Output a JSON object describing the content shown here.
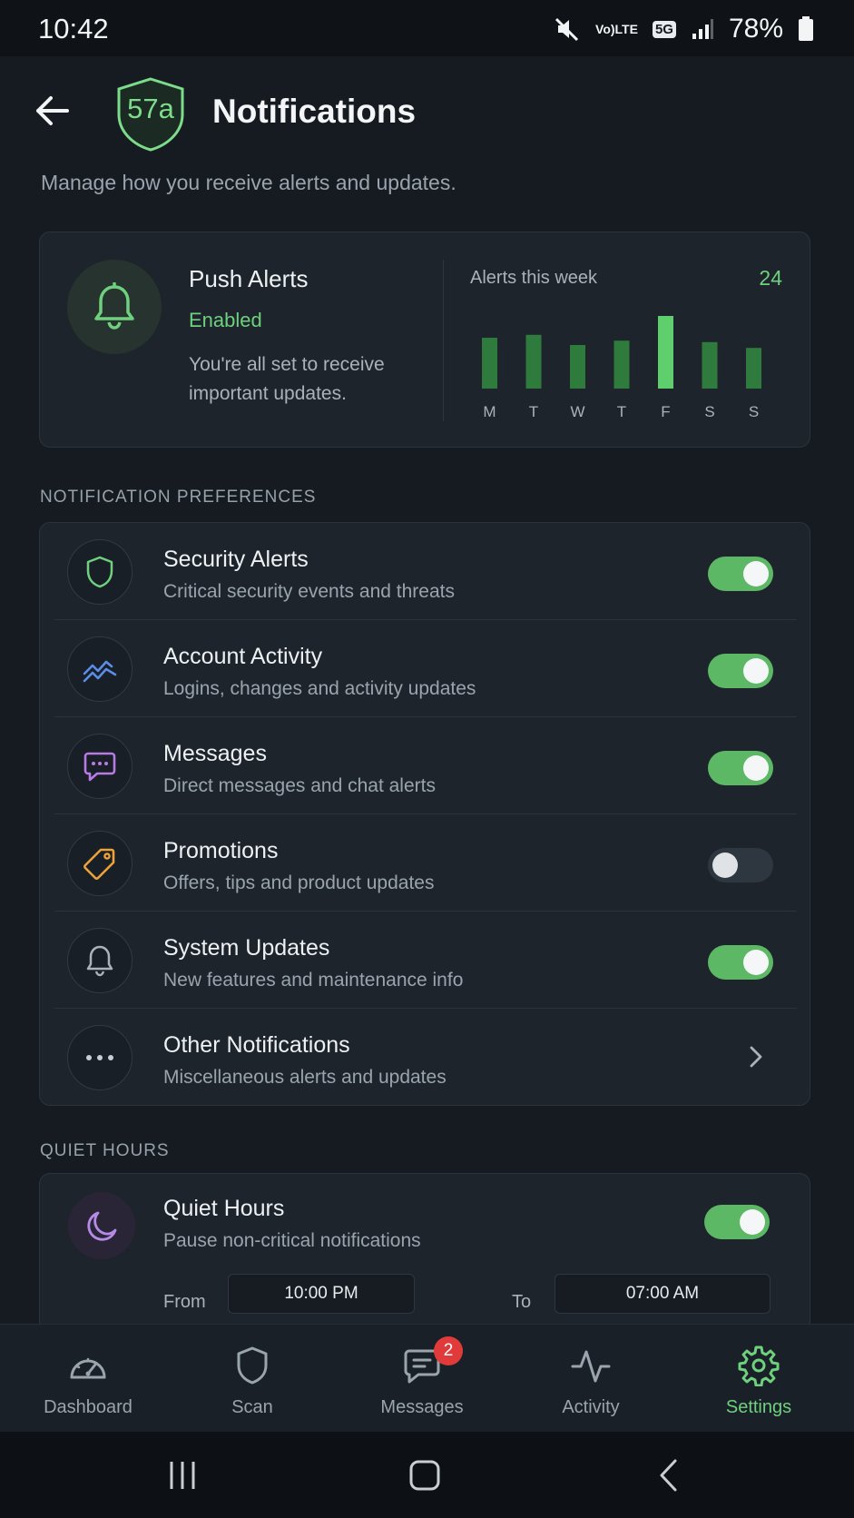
{
  "status_bar": {
    "time": "10:42",
    "volte_top": "Vo)",
    "volte_bottom": "LTE",
    "network": "5G",
    "battery": "78%",
    "icons": [
      "mute-icon",
      "signal-icon",
      "battery-icon"
    ]
  },
  "header": {
    "logo_text": "57a",
    "title": "Notifications",
    "subtitle": "Manage how you receive alerts and updates."
  },
  "push_card": {
    "title": "Push Alerts",
    "status": "Enabled",
    "description": "You're all set to receive important updates.",
    "week_label": "Alerts this week",
    "week_count": "24",
    "days": [
      "M",
      "T",
      "W",
      "T",
      "F",
      "S",
      "S"
    ],
    "values": [
      3.5,
      3.7,
      3.0,
      3.3,
      5.0,
      3.2,
      2.8
    ]
  },
  "preferences": {
    "section_label": "NOTIFICATION PREFERENCES",
    "items": [
      {
        "title": "Security Alerts",
        "desc": "Critical security events and threats",
        "icon": "shield-icon",
        "enabled": true
      },
      {
        "title": "Account Activity",
        "desc": "Logins, changes and activity updates",
        "icon": "activity-chart-icon",
        "enabled": true
      },
      {
        "title": "Messages",
        "desc": "Direct messages and chat alerts",
        "icon": "chat-bubble-icon",
        "enabled": true
      },
      {
        "title": "Promotions",
        "desc": "Offers, tips and product updates",
        "icon": "tag-icon",
        "enabled": false
      },
      {
        "title": "System Updates",
        "desc": "New features and maintenance info",
        "icon": "bell-icon",
        "enabled": true
      },
      {
        "title": "Other Notifications",
        "desc": "Miscellaneous alerts and updates",
        "icon": "more-dots-icon",
        "action": "chevron"
      }
    ]
  },
  "quiet_hours": {
    "section_label": "QUIET HOURS",
    "title": "Quiet Hours",
    "desc": "Pause non-critical notifications",
    "enabled": true,
    "from_label": "From",
    "from_value": "10:00 PM",
    "to_label": "To",
    "to_value": "07:00 AM"
  },
  "bottom_nav": {
    "items": [
      {
        "label": "Dashboard",
        "icon": "gauge-icon"
      },
      {
        "label": "Scan",
        "icon": "shield-icon"
      },
      {
        "label": "Messages",
        "icon": "chat-icon",
        "badge": "2"
      },
      {
        "label": "Activity",
        "icon": "pulse-icon"
      },
      {
        "label": "Settings",
        "icon": "gear-icon",
        "active": true
      }
    ]
  },
  "colors": {
    "accent": "#6fd07d",
    "toggle_on": "#5cb865",
    "background": "#161b22",
    "card": "#1d242c",
    "badge": "#e03a3a"
  }
}
